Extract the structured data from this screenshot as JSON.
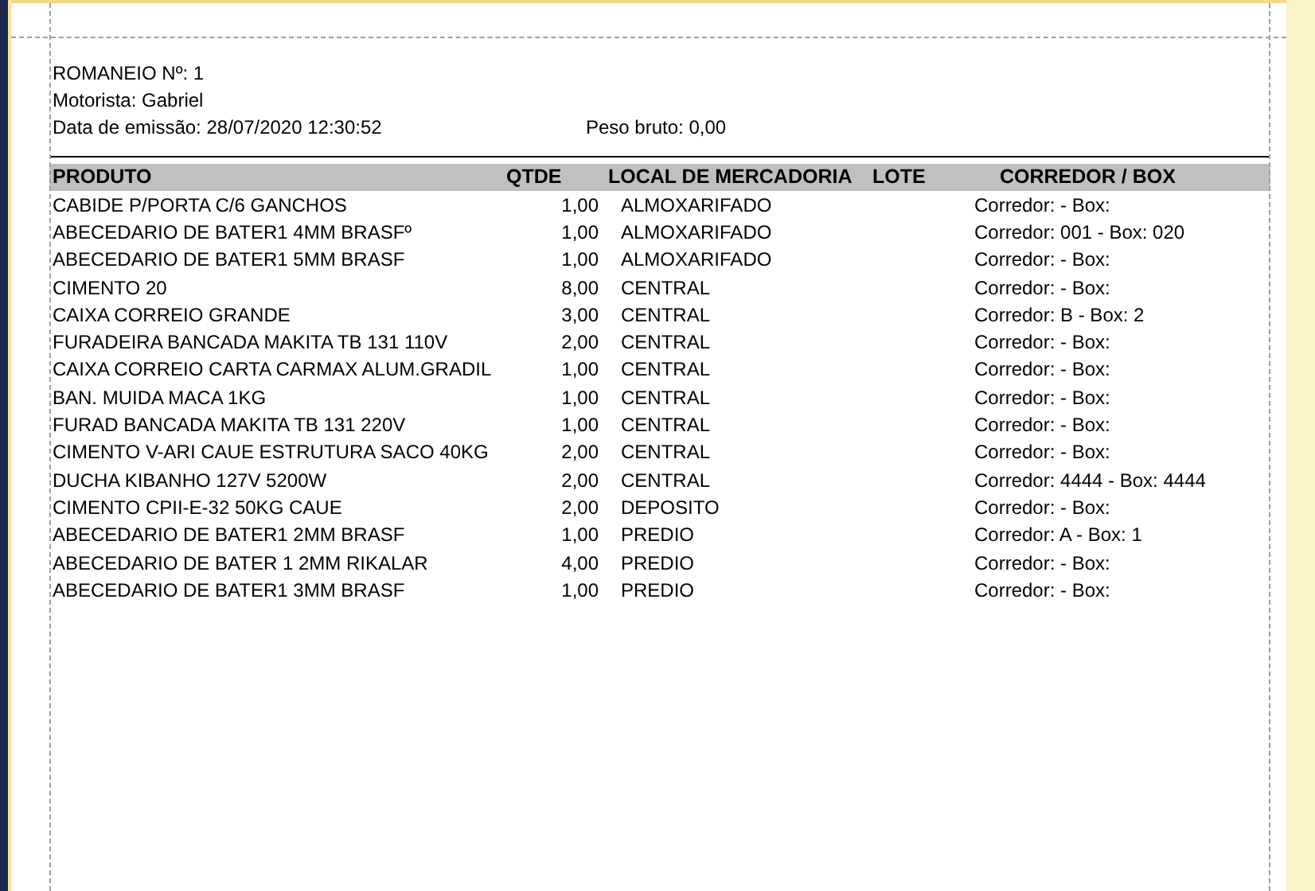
{
  "header": {
    "title": "ROMANEIO Nº: 1",
    "driver": "Motorista: Gabriel",
    "issue_date": "Data de emissão: 28/07/2020 12:30:52",
    "gross_weight": "Peso bruto: 0,00"
  },
  "table": {
    "columns": [
      "PRODUTO",
      "QTDE",
      "LOCAL DE MERCADORIA",
      "LOTE",
      "CORREDOR / BOX"
    ],
    "rows": [
      [
        "CABIDE P/PORTA C/6 GANCHOS",
        "1,00",
        "ALMOXARIFADO",
        "Corredor:  - Box:"
      ],
      [
        "ABECEDARIO DE BATER1 4MM BRASFº",
        "1,00",
        "ALMOXARIFADO",
        "Corredor: 001 - Box: 020"
      ],
      [
        "ABECEDARIO DE BATER1 5MM BRASF",
        "1,00",
        "ALMOXARIFADO",
        "Corredor:  - Box:"
      ],
      [
        "CIMENTO 20",
        "8,00",
        "CENTRAL",
        "Corredor:  - Box:"
      ],
      [
        "CAIXA CORREIO GRANDE",
        "3,00",
        "CENTRAL",
        "Corredor: B - Box: 2"
      ],
      [
        "FURADEIRA BANCADA MAKITA TB 131 110V",
        "2,00",
        "CENTRAL",
        "Corredor:  - Box:"
      ],
      [
        "CAIXA CORREIO CARTA CARMAX ALUM.GRADIL",
        "1,00",
        "CENTRAL",
        "Corredor:  - Box:"
      ],
      [
        "BAN. MUIDA MACA 1KG",
        "1,00",
        "CENTRAL",
        "Corredor:  - Box:"
      ],
      [
        "FURAD BANCADA MAKITA TB 131 220V",
        "1,00",
        "CENTRAL",
        "Corredor:  - Box:"
      ],
      [
        "CIMENTO V-ARI CAUE ESTRUTURA SACO 40KG",
        "2,00",
        "CENTRAL",
        "Corredor:  - Box:"
      ],
      [
        "DUCHA KIBANHO 127V 5200W",
        "2,00",
        "CENTRAL",
        "Corredor: 4444 - Box: 4444"
      ],
      [
        "CIMENTO CPII-E-32 50KG CAUE",
        "2,00",
        "DEPOSITO",
        "Corredor:  - Box:"
      ],
      [
        "ABECEDARIO DE BATER1 2MM BRASF",
        "1,00",
        "PREDIO",
        "Corredor: A - Box: 1"
      ],
      [
        "ABECEDARIO DE BATER 1 2MM RIKALAR",
        "4,00",
        "PREDIO",
        "Corredor:  - Box:"
      ],
      [
        "ABECEDARIO DE BATER1 3MM BRASF",
        "1,00",
        "PREDIO",
        "Corredor:  - Box:"
      ]
    ]
  }
}
